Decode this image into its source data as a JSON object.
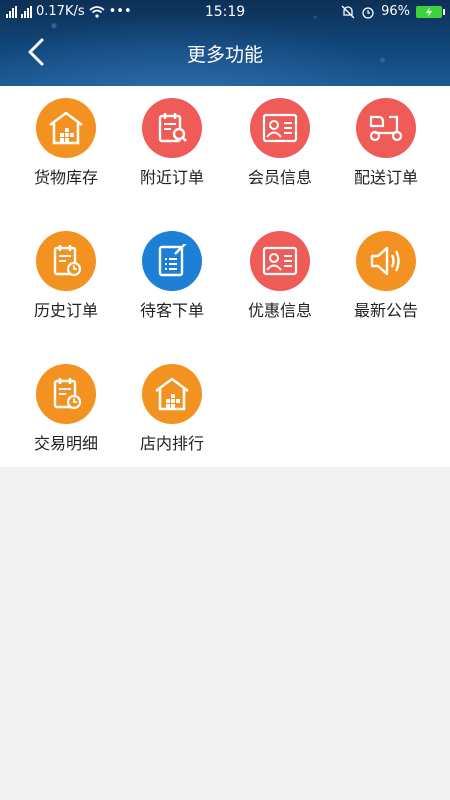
{
  "status_bar": {
    "network_speed": "0.17K/s",
    "time": "15:19",
    "battery": "96%"
  },
  "header": {
    "title": "更多功能"
  },
  "grid": {
    "items": [
      {
        "label": "货物库存",
        "icon": "warehouse-icon",
        "color": "#f39221"
      },
      {
        "label": "附近订单",
        "icon": "order-search-icon",
        "color": "#ef5b57"
      },
      {
        "label": "会员信息",
        "icon": "member-card-icon",
        "color": "#ef5b57"
      },
      {
        "label": "配送订单",
        "icon": "scooter-icon",
        "color": "#ef5b57"
      },
      {
        "label": "历史订单",
        "icon": "order-history-icon",
        "color": "#f39221"
      },
      {
        "label": "待客下单",
        "icon": "order-form-icon",
        "color": "#1e7fd6"
      },
      {
        "label": "优惠信息",
        "icon": "discount-card-icon",
        "color": "#ef5b57"
      },
      {
        "label": "最新公告",
        "icon": "speaker-icon",
        "color": "#f39221"
      },
      {
        "label": "交易明细",
        "icon": "transaction-detail-icon",
        "color": "#f39221"
      },
      {
        "label": "店内排行",
        "icon": "store-ranking-icon",
        "color": "#f39221"
      }
    ]
  }
}
